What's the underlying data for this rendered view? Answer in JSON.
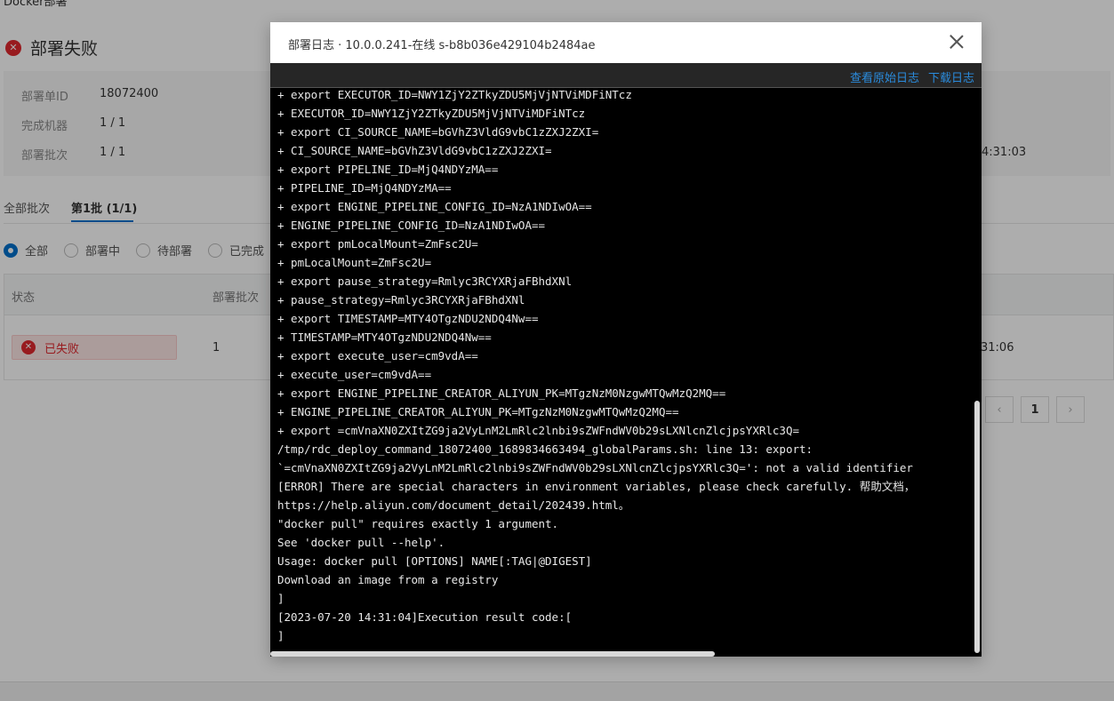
{
  "background": {
    "breadcrumb": "Docker部署",
    "status_title": "部署失败",
    "info": [
      {
        "label": "部署单ID",
        "value": "18072400"
      },
      {
        "label": "完成机器",
        "value": "1 / 1"
      },
      {
        "label": "部署批次",
        "value": "1 / 1"
      }
    ],
    "info_right_time": "4:31:03",
    "tabs": [
      "全部批次",
      "第1批 (1/1)"
    ],
    "radios": [
      "全部",
      "部署中",
      "待部署",
      "已完成"
    ],
    "table_headers": [
      "状态",
      "部署批次"
    ],
    "row": {
      "status": "已失败",
      "batch": "1",
      "time": "31:06"
    },
    "pager": {
      "prev": "‹",
      "page": "1",
      "next": "›"
    }
  },
  "dialog": {
    "title": "部署日志 · 10.0.0.241-在线 s-b8b036e429104b2484ae",
    "links": {
      "raw_log": "查看原始日志",
      "download_log": "下载日志"
    },
    "log_lines": [
      "+ export EXECUTOR_ID=NWY1ZjY2ZTkyZDU5MjVjNTViMDFiNTcz",
      "+ EXECUTOR_ID=NWY1ZjY2ZTkyZDU5MjVjNTViMDFiNTcz",
      "+ export CI_SOURCE_NAME=bGVhZ3VldG9vbC1zZXJ2ZXI=",
      "+ CI_SOURCE_NAME=bGVhZ3VldG9vbC1zZXJ2ZXI=",
      "+ export PIPELINE_ID=MjQ4NDYzMA==",
      "+ PIPELINE_ID=MjQ4NDYzMA==",
      "+ export ENGINE_PIPELINE_CONFIG_ID=NzA1NDIwOA==",
      "+ ENGINE_PIPELINE_CONFIG_ID=NzA1NDIwOA==",
      "+ export pmLocalMount=ZmFsc2U=",
      "+ pmLocalMount=ZmFsc2U=",
      "+ export pause_strategy=Rmlyc3RCYXRjaFBhdXNl",
      "+ pause_strategy=Rmlyc3RCYXRjaFBhdXNl",
      "+ export TIMESTAMP=MTY4OTgzNDU2NDQ4Nw==",
      "+ TIMESTAMP=MTY4OTgzNDU2NDQ4Nw==",
      "+ export execute_user=cm9vdA==",
      "+ execute_user=cm9vdA==",
      "+ export ENGINE_PIPELINE_CREATOR_ALIYUN_PK=MTgzNzM0NzgwMTQwMzQ2MQ==",
      "+ ENGINE_PIPELINE_CREATOR_ALIYUN_PK=MTgzNzM0NzgwMTQwMzQ2MQ==",
      "+ export =cmVnaXN0ZXItZG9ja2VyLnM2LmRlc2lnbi9sZWFndWV0b29sLXNlcnZlcjpsYXRlc3Q=",
      "/tmp/rdc_deploy_command_18072400_1689834663494_globalParams.sh: line 13: export:",
      "`=cmVnaXN0ZXItZG9ja2VyLnM2LmRlc2lnbi9sZWFndWV0b29sLXNlcnZlcjpsYXRlc3Q=': not a valid identifier",
      "[ERROR] There are special characters in environment variables, please check carefully. 帮助文档，",
      "https://help.aliyun.com/document_detail/202439.html。",
      "\"docker pull\" requires exactly 1 argument.",
      "See 'docker pull --help'.",
      "Usage: docker pull [OPTIONS] NAME[:TAG|@DIGEST]",
      "Download an image from a registry",
      "]",
      "[2023-07-20 14:31:04]Execution result code:[",
      "]"
    ]
  },
  "colors": {
    "accent": "#0070cc",
    "error": "#e0282e",
    "link": "#2a8bdc",
    "terminal_bg": "#000000"
  }
}
